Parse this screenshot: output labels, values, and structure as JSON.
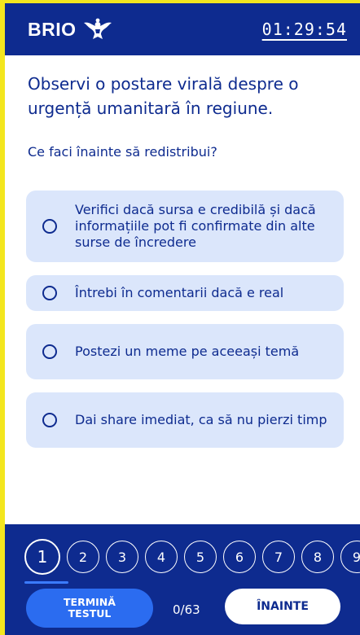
{
  "header": {
    "brand": "BRIO",
    "logo_icon": "eagle-logo-icon",
    "timer": "01:29:54"
  },
  "question": {
    "text": "Observi o postare virală despre o urgență umanitară în regiune.",
    "prompt": "Ce faci înainte să redistribui?"
  },
  "options": [
    {
      "label": "Verifici dacă sursa e credibilă și dacă informațiile pot fi confirmate din alte surse de încredere"
    },
    {
      "label": "Întrebi în comentarii dacă e real"
    },
    {
      "label": "Postezi un meme pe aceeași temă"
    },
    {
      "label": "Dai share imediat, ca să nu pierzi timp"
    }
  ],
  "steps": [
    "1",
    "2",
    "3",
    "4",
    "5",
    "6",
    "7",
    "8",
    "9"
  ],
  "active_step": "1",
  "footer": {
    "end_label_line1": "TERMINĂ",
    "end_label_line2": "TESTUL",
    "progress": "0/63",
    "next_label": "ÎNAINTE"
  },
  "colors": {
    "primary": "#0e2b8f",
    "option_bg": "#dbe6fb",
    "accent": "#2b6cf0",
    "border": "#f3e61e"
  }
}
